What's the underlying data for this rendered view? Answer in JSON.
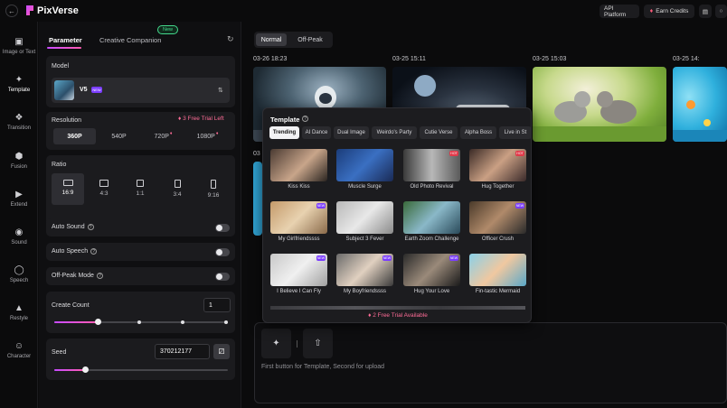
{
  "app": {
    "name": "PixVerse",
    "api_label": "API Platform",
    "earn_label": "Earn Credits",
    "accent": "#c84bff"
  },
  "nav": {
    "items": [
      {
        "label": "Image or Text",
        "icon": "image-icon"
      },
      {
        "label": "Template",
        "icon": "sparkle-icon",
        "active": true
      },
      {
        "label": "Transition",
        "icon": "transition-icon"
      },
      {
        "label": "Fusion",
        "icon": "cube-icon"
      },
      {
        "label": "Extend",
        "icon": "extend-icon"
      },
      {
        "label": "Sound",
        "icon": "sound-icon"
      },
      {
        "label": "Speech",
        "icon": "lips-icon"
      },
      {
        "label": "Restyle",
        "icon": "brush-icon"
      },
      {
        "label": "Character",
        "icon": "face-icon"
      }
    ]
  },
  "panel": {
    "tab_parameter": "Parameter",
    "tab_creative": "Creative Companion",
    "new_badge": "New",
    "model": {
      "label": "Model",
      "name": "V5",
      "badge": "NEW"
    },
    "resolution": {
      "label": "Resolution",
      "trial": "3 Free Trial Left",
      "options": [
        "360P",
        "540P",
        "720P",
        "1080P"
      ],
      "selected": "360P"
    },
    "ratio": {
      "label": "Ratio",
      "options": [
        "16:9",
        "4:3",
        "1:1",
        "3:4",
        "9:16"
      ],
      "selected": "16:9"
    },
    "auto_sound": {
      "label": "Auto Sound",
      "on": false
    },
    "auto_speech": {
      "label": "Auto Speech",
      "on": false
    },
    "off_peak": {
      "label": "Off-Peak Mode",
      "on": false
    },
    "create_count": {
      "label": "Create Count",
      "value": "1",
      "fraction": 0.25
    },
    "seed": {
      "label": "Seed",
      "value": "370212177",
      "fraction": 0.18
    }
  },
  "main": {
    "mode_normal": "Normal",
    "mode_offpeak": "Off-Peak",
    "videos": [
      {
        "date": "03-26 18:23"
      },
      {
        "date": "03-25 15:11"
      },
      {
        "date": "03-25 15:03"
      },
      {
        "date": "03-25 14:"
      },
      {
        "date": "03"
      }
    ],
    "prompt_hint": "First button for Template, Second for upload"
  },
  "template_popup": {
    "title": "Template",
    "categories": [
      "Trending",
      "AI Dance",
      "Dual Image",
      "Weirdo's Party",
      "Cutie Verse",
      "Alpha Boss",
      "Live in St"
    ],
    "selected": "Trending",
    "templates": [
      {
        "label": "Kiss Kiss",
        "badge": ""
      },
      {
        "label": "Muscle Surge",
        "badge": ""
      },
      {
        "label": "Old Photo Revival",
        "badge": "HOT"
      },
      {
        "label": "Hug Together",
        "badge": "HOT"
      },
      {
        "label": "My Girlfriendssss",
        "badge": "NEW"
      },
      {
        "label": "Subject 3 Fever",
        "badge": ""
      },
      {
        "label": "Earth Zoom Challenge",
        "badge": ""
      },
      {
        "label": "Officer Crush",
        "badge": "NEW"
      },
      {
        "label": "I Believe I Can Fly",
        "badge": "NEW"
      },
      {
        "label": "My Boyfriendssss",
        "badge": "NEW"
      },
      {
        "label": "Hug Your Love",
        "badge": "NEW"
      },
      {
        "label": "Fin-tastic Mermaid",
        "badge": ""
      }
    ],
    "trial": "2 Free Trial Available"
  }
}
